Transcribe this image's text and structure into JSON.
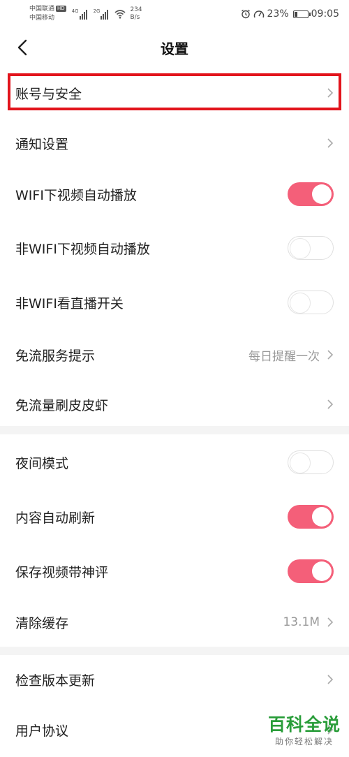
{
  "status_bar": {
    "carrier1": "中国联通",
    "carrier1_badge": "HD",
    "carrier2": "中国移动",
    "net1": "4G",
    "net2": "2G",
    "speed_value": "234",
    "speed_unit": "B/s",
    "battery_percent": "23%",
    "battery_level": 0.23,
    "time": "09:05"
  },
  "nav": {
    "title": "设置"
  },
  "settings": [
    {
      "label": "账号与安全",
      "kind": "link"
    },
    {
      "label": "通知设置",
      "kind": "link"
    },
    {
      "label": "WIFI下视频自动播放",
      "kind": "toggle",
      "on": true
    },
    {
      "label": "非WIFI下视频自动播放",
      "kind": "toggle",
      "on": false
    },
    {
      "label": "非WIFI看直播开关",
      "kind": "toggle",
      "on": false
    },
    {
      "label": "免流服务提示",
      "kind": "link",
      "value": "每日提醒一次"
    },
    {
      "label": "免流量刷皮皮虾",
      "kind": "link"
    },
    {
      "label": "夜间模式",
      "kind": "toggle",
      "on": false
    },
    {
      "label": "内容自动刷新",
      "kind": "toggle",
      "on": true
    },
    {
      "label": "保存视频带神评",
      "kind": "toggle",
      "on": true
    },
    {
      "label": "清除缓存",
      "kind": "link",
      "value": "13.1M"
    },
    {
      "label": "检查版本更新",
      "kind": "link"
    },
    {
      "label": "用户协议",
      "kind": "link"
    }
  ],
  "watermark": {
    "main": "百科全说",
    "sub": "助你轻松解决"
  },
  "colors": {
    "toggle_on": "#f45f79",
    "highlight": "#e2141c",
    "watermark": "#2a9d3a"
  }
}
